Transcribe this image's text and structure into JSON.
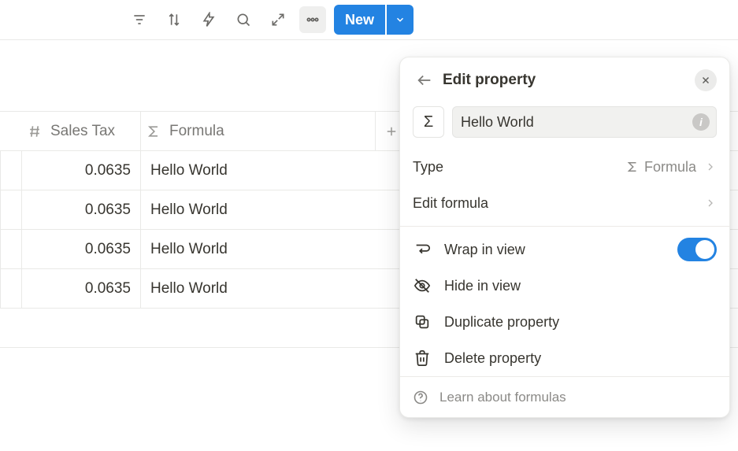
{
  "toolbar": {
    "new_label": "New"
  },
  "table": {
    "columns": {
      "sales_tax": "Sales Tax",
      "formula": "Formula"
    },
    "rows": [
      {
        "sales_tax": "0.0635",
        "formula": "Hello World"
      },
      {
        "sales_tax": "0.0635",
        "formula": "Hello World"
      },
      {
        "sales_tax": "0.0635",
        "formula": "Hello World"
      },
      {
        "sales_tax": "0.0635",
        "formula": "Hello World"
      }
    ]
  },
  "panel": {
    "title": "Edit property",
    "sigma": "Σ",
    "name_value": "Hello World",
    "type_label": "Type",
    "type_value": "Formula",
    "edit_formula": "Edit formula",
    "wrap": "Wrap in view",
    "wrap_on": true,
    "hide": "Hide in view",
    "duplicate": "Duplicate property",
    "delete": "Delete property",
    "learn": "Learn about formulas"
  }
}
